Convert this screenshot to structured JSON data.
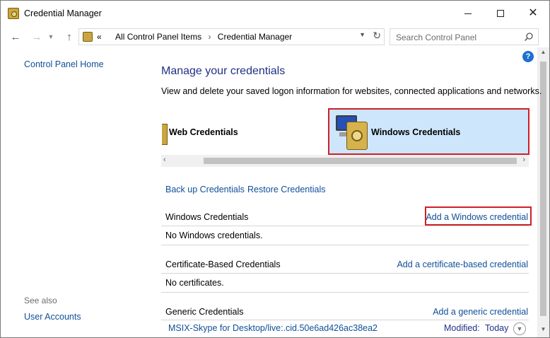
{
  "window": {
    "title": "Credential Manager",
    "icon": "credential-vault-icon"
  },
  "address": {
    "overflow": "«",
    "crumbs": [
      "All Control Panel Items",
      "Credential Manager"
    ],
    "separator": "›"
  },
  "search": {
    "placeholder": "Search Control Panel"
  },
  "sidebar": {
    "home_link": "Control Panel Home",
    "see_also": "See also",
    "user_accounts": "User Accounts"
  },
  "main": {
    "heading": "Manage your credentials",
    "subtext": "View and delete your saved logon information for websites, connected applications and networks.",
    "tiles": {
      "web": "Web Credentials",
      "windows": "Windows Credentials",
      "selected": "windows"
    },
    "links": {
      "backup": "Back up Credentials",
      "restore": "Restore Credentials"
    },
    "sections": {
      "windows": {
        "title": "Windows Credentials",
        "action": "Add a Windows credential",
        "empty": "No Windows credentials."
      },
      "certificate": {
        "title": "Certificate-Based Credentials",
        "action": "Add a certificate-based credential",
        "empty": "No certificates."
      },
      "generic": {
        "title": "Generic Credentials",
        "action": "Add a generic credential",
        "items": [
          {
            "name": "MSIX-Skype for Desktop/live:.cid.50e6ad426ac38ea2",
            "modified_label": "Modified:",
            "modified_value": "Today"
          }
        ]
      }
    }
  },
  "colors": {
    "link": "#0f4f99",
    "heading": "#1e3287",
    "highlight": "#d01f2a",
    "selected_tile": "#cde6fb"
  }
}
